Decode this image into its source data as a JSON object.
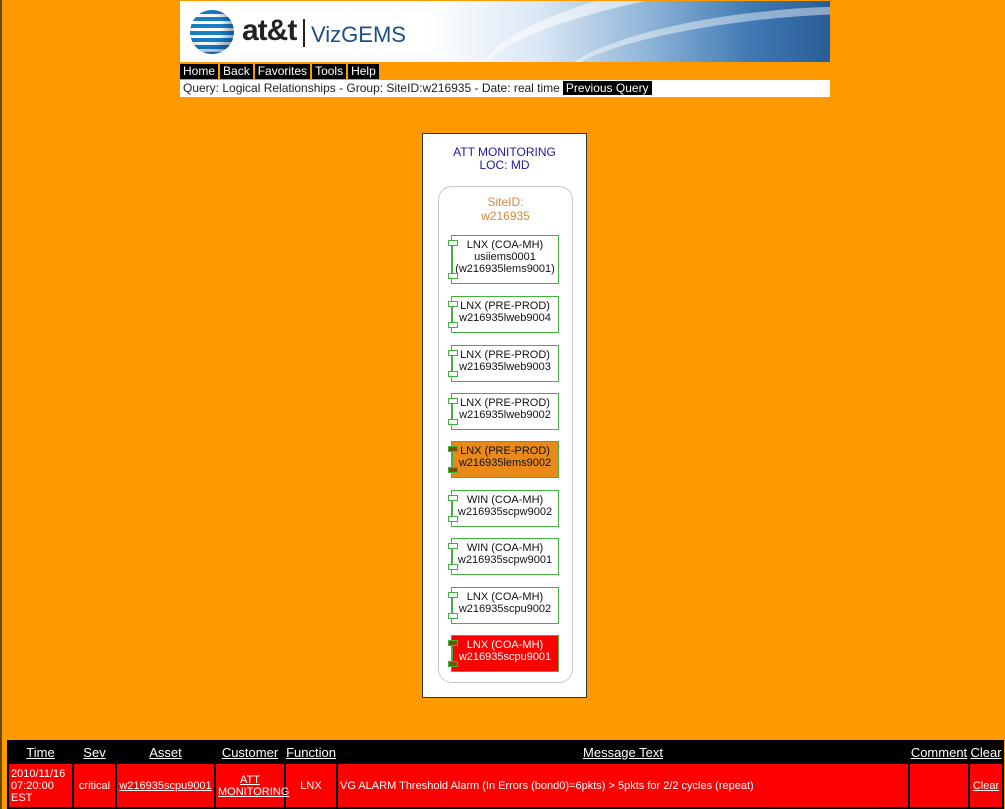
{
  "header": {
    "brand": "at&t",
    "product": "VizGEMS"
  },
  "menu": [
    "Home",
    "Back",
    "Favorites",
    "Tools",
    "Help"
  ],
  "query": {
    "text": "Query: Logical Relationships - Group: SiteID:w216935 - Date: real time",
    "previous_label": "Previous Query"
  },
  "panel": {
    "title_line1": "ATT MONITORING",
    "title_line2": "LOC: MD",
    "site_label_line1": "SiteID:",
    "site_label_line2": "w216935",
    "nodes": [
      {
        "line1": "LNX (COA-MH)",
        "line2": "usiiems0001",
        "line3": "(w216935lems9001)",
        "status": "ok"
      },
      {
        "line1": "LNX (PRE-PROD)",
        "line2": "w216935lweb9004",
        "status": "ok"
      },
      {
        "line1": "LNX (PRE-PROD)",
        "line2": "w216935lweb9003",
        "status": "ok"
      },
      {
        "line1": "LNX (PRE-PROD)",
        "line2": "w216935lweb9002",
        "status": "ok"
      },
      {
        "line1": "LNX (PRE-PROD)",
        "line2": "w216935lems9002",
        "status": "warning"
      },
      {
        "line1": "WIN (COA-MH)",
        "line2": "w216935scpw9002",
        "status": "ok"
      },
      {
        "line1": "WIN (COA-MH)",
        "line2": "w216935scpw9001",
        "status": "ok"
      },
      {
        "line1": "LNX (COA-MH)",
        "line2": "w216935scpu9002",
        "status": "ok"
      },
      {
        "line1": "LNX (COA-MH)",
        "line2": "w216935scpu9001",
        "status": "critical"
      }
    ]
  },
  "alarms": {
    "columns": [
      "Time",
      "Sev",
      "Asset",
      "Customer",
      "Function",
      "Message Text",
      "Comment",
      "Clear"
    ],
    "rows": [
      {
        "time_line1": "2010/11/16",
        "time_line2": "07:20:00",
        "time_line3": "EST",
        "sev": "critical",
        "asset": "w216935scpu9001",
        "customer_line1": "ATT",
        "customer_line2": "MONITORING",
        "function": "LNX",
        "message": "VG ALARM Threshold Alarm (In Errors (bond0)=6pkts) > 5pkts for 2/2 cycles (repeat)",
        "comment": "",
        "clear": "Clear"
      }
    ]
  },
  "colors": {
    "background": "#ff9900",
    "critical": "#ff0000",
    "warning": "#e8891a",
    "ok_border": "#3fb23f"
  }
}
